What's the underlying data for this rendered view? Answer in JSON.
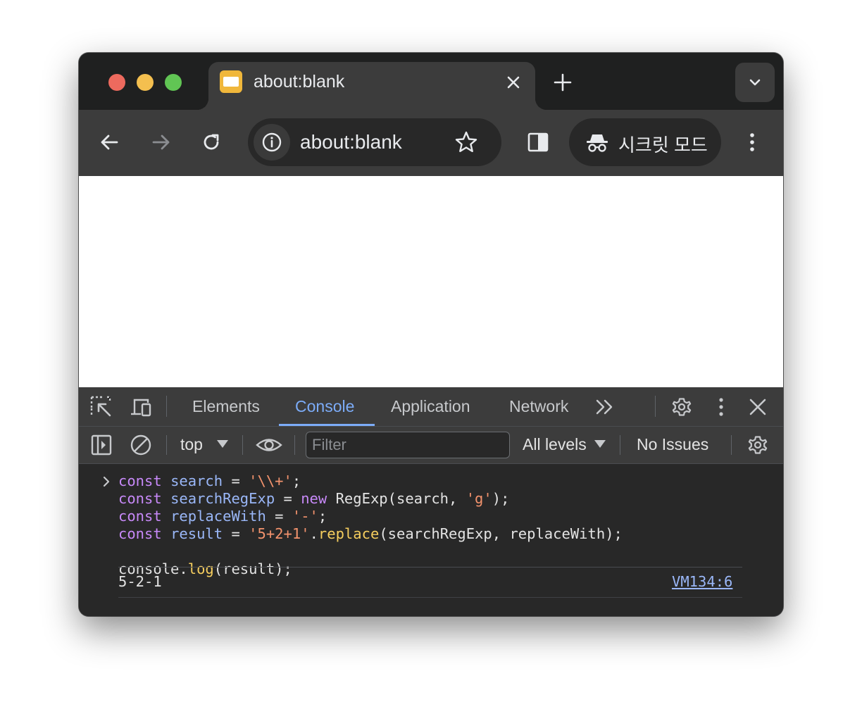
{
  "tab": {
    "title": "about:blank"
  },
  "toolbar": {
    "url": "about:blank",
    "incognito_label": "시크릿 모드"
  },
  "devtools": {
    "tabs": [
      {
        "label": "Elements",
        "active": false
      },
      {
        "label": "Console",
        "active": true
      },
      {
        "label": "Application",
        "active": false
      },
      {
        "label": "Network",
        "active": false
      }
    ],
    "console_toolbar": {
      "context": "top",
      "filter_placeholder": "Filter",
      "levels": "All levels",
      "issues": "No Issues"
    }
  },
  "console": {
    "code_lines": [
      [
        {
          "t": "const",
          "c": "kw"
        },
        {
          "t": " ",
          "c": "plain"
        },
        {
          "t": "search",
          "c": "var"
        },
        {
          "t": " = ",
          "c": "plain"
        },
        {
          "t": "'\\\\+'",
          "c": "str"
        },
        {
          "t": ";",
          "c": "plain"
        }
      ],
      [
        {
          "t": "const",
          "c": "kw"
        },
        {
          "t": " ",
          "c": "plain"
        },
        {
          "t": "searchRegExp",
          "c": "var"
        },
        {
          "t": " = ",
          "c": "plain"
        },
        {
          "t": "new",
          "c": "kw"
        },
        {
          "t": " RegExp(search, ",
          "c": "plain"
        },
        {
          "t": "'g'",
          "c": "str"
        },
        {
          "t": ");",
          "c": "plain"
        }
      ],
      [
        {
          "t": "const",
          "c": "kw"
        },
        {
          "t": " ",
          "c": "plain"
        },
        {
          "t": "replaceWith",
          "c": "var"
        },
        {
          "t": " = ",
          "c": "plain"
        },
        {
          "t": "'-'",
          "c": "str"
        },
        {
          "t": ";",
          "c": "plain"
        }
      ],
      [
        {
          "t": "const",
          "c": "kw"
        },
        {
          "t": " ",
          "c": "plain"
        },
        {
          "t": "result",
          "c": "var"
        },
        {
          "t": " = ",
          "c": "plain"
        },
        {
          "t": "'5+2+1'",
          "c": "str"
        },
        {
          "t": ".",
          "c": "plain"
        },
        {
          "t": "replace",
          "c": "fn"
        },
        {
          "t": "(searchRegExp, replaceWith);",
          "c": "plain"
        }
      ],
      [],
      [
        {
          "t": "console.",
          "c": "plain"
        },
        {
          "t": "log",
          "c": "fn"
        },
        {
          "t": "(result);",
          "c": "plain"
        }
      ]
    ],
    "output": "5-2-1",
    "source": "VM134:6"
  },
  "icons": {
    "tab_close": "close-icon",
    "new_tab": "plus-icon",
    "tab_search": "chevron-down-icon",
    "back": "arrow-left-icon",
    "forward": "arrow-right-icon",
    "reload": "reload-icon",
    "site_info": "info-icon",
    "bookmark": "star-icon",
    "side_panel": "side-panel-icon",
    "incognito": "incognito-icon",
    "menu": "kebab-menu-icon"
  },
  "colors": {
    "keyword": "#c789f8",
    "variable": "#9ab7f8",
    "string": "#f3936d",
    "function": "#f6ce5e",
    "accent": "#7cacf8",
    "traffic_red": "#ed6a5e",
    "traffic_yellow": "#f4bf4f",
    "traffic_green": "#61c554"
  }
}
